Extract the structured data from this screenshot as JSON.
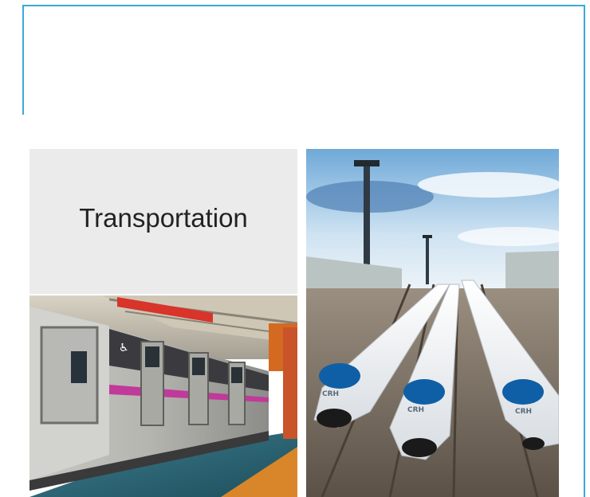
{
  "section": {
    "label": "Transportation"
  },
  "photos": {
    "subway": {
      "icon": "subway-train-photo",
      "train_mark": "♿"
    },
    "high_speed": {
      "icon": "high-speed-train-photo",
      "train_code": "CRH"
    }
  },
  "colors": {
    "frame": "#3aa8d8",
    "panel": "#ebebeb",
    "stripe": "#c03a9a"
  }
}
